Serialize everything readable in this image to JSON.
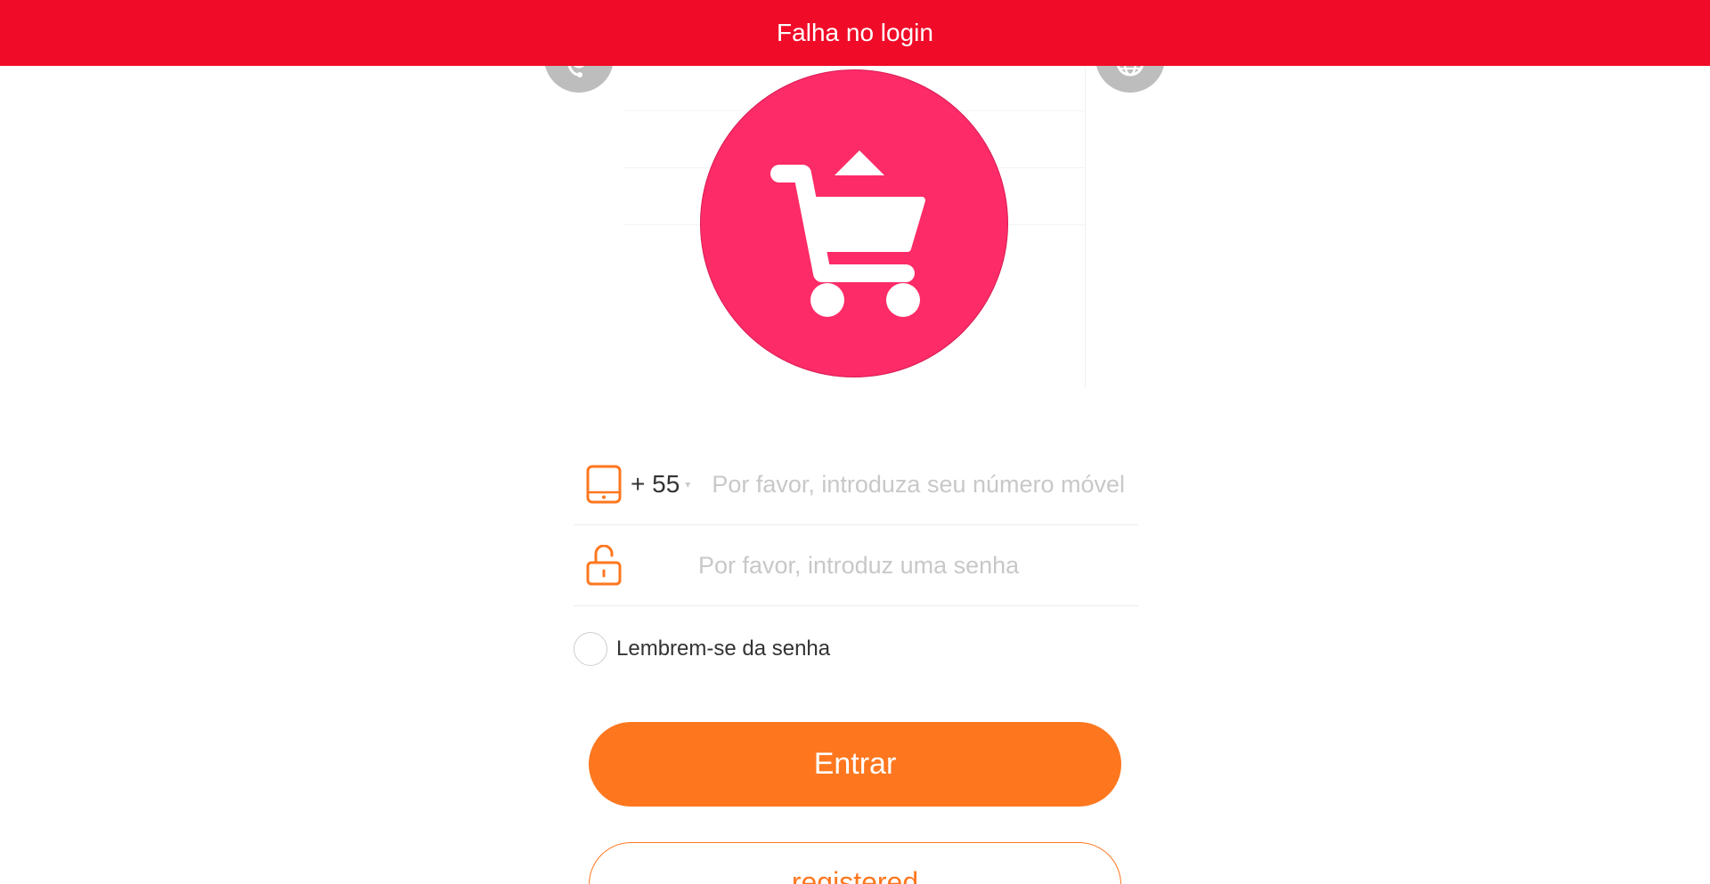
{
  "banner": {
    "message": "Falha no login"
  },
  "header_icons": {
    "left": "customer-service-icon",
    "right": "language-globe-icon"
  },
  "logo": {
    "icon": "shopping-cart-icon",
    "color": "#fd2b67"
  },
  "form": {
    "phone": {
      "country_code": "+ 55",
      "placeholder": "Por favor, introduza seu número móvel",
      "value": ""
    },
    "password": {
      "placeholder": "Por favor, introduz uma senha",
      "value": ""
    },
    "remember_label": "Lembrem-se da senha"
  },
  "buttons": {
    "login_label": "Entrar",
    "register_label": "registered"
  },
  "colors": {
    "banner": "#f00b28",
    "accent": "#fe771f"
  }
}
